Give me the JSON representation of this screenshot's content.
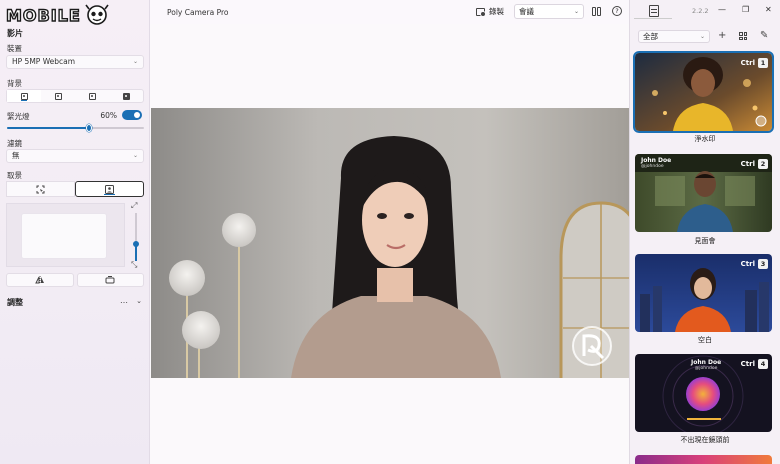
{
  "brand": {
    "logo_text": "MOBILE"
  },
  "left_panel": {
    "section_title": "影片",
    "device": {
      "label": "裝置",
      "value": "HP 5MP Webcam"
    },
    "background": {
      "label": "背景"
    },
    "backlight": {
      "label": "緊光燈",
      "value": "60%",
      "enabled": true,
      "level": 0.6
    },
    "filter": {
      "label": "濾鏡",
      "value": "無"
    },
    "framing": {
      "label": "取景"
    },
    "adjust": {
      "label": "調整",
      "more": "…"
    }
  },
  "topbar": {
    "app_title": "Poly Camera Pro",
    "record_label": "錄製",
    "meeting_value": "會議"
  },
  "right_panel": {
    "version": "2.2.2",
    "filter_value": "全部",
    "cards": [
      {
        "label": "淨水印",
        "ctrl": "Ctrl",
        "num": "1",
        "selected": true
      },
      {
        "label": "見面會",
        "ctrl": "Ctrl",
        "num": "2",
        "name": "John Doe",
        "handle": "@johndoe"
      },
      {
        "label": "空白",
        "ctrl": "Ctrl",
        "num": "3"
      },
      {
        "label": "不出現在鏡頭前",
        "ctrl": "Ctrl",
        "num": "4",
        "name": "John Doe",
        "handle": "@johndoe"
      }
    ]
  },
  "colors": {
    "accent": "#1a6fb4",
    "selected_outline": "#1a6fb4"
  }
}
